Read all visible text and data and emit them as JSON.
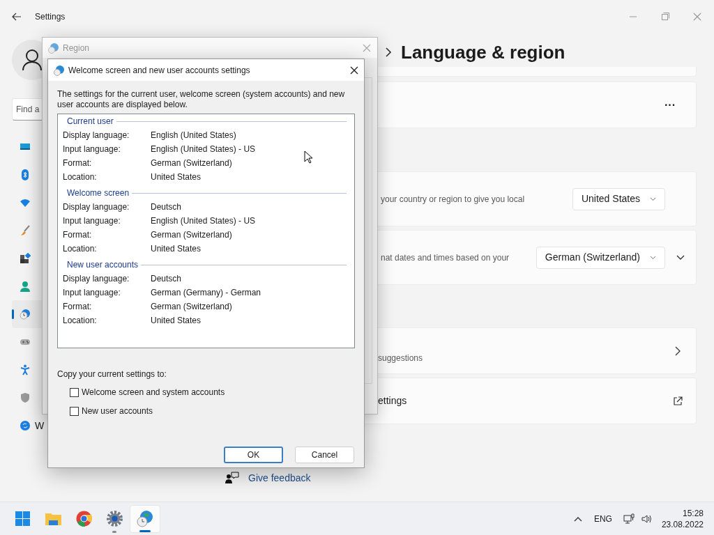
{
  "settings_window": {
    "title": "Settings",
    "search": {
      "placeholder": "Find a"
    },
    "nav": [
      {
        "kind": "display",
        "selected": false
      },
      {
        "kind": "bluetooth",
        "selected": false
      },
      {
        "kind": "wifi",
        "selected": false
      },
      {
        "kind": "brush",
        "selected": false
      },
      {
        "kind": "apps",
        "selected": false
      },
      {
        "kind": "account",
        "selected": false
      },
      {
        "kind": "time",
        "selected": true
      },
      {
        "kind": "gaming",
        "selected": false
      },
      {
        "kind": "accessibility",
        "selected": false
      },
      {
        "kind": "shield",
        "selected": false
      },
      {
        "kind": "update",
        "selected": false,
        "label": "W"
      }
    ],
    "heading": "Language & region",
    "cards": [
      {
        "kind": "partial"
      },
      {
        "kind": "more",
        "label": "···"
      },
      {
        "kind": "dropdown",
        "description": "your country or region to give you local",
        "value": "United States"
      },
      {
        "kind": "dropdown",
        "description": "nat dates and times based on your",
        "value": "German (Switzerland)",
        "expanded": false
      },
      {
        "kind": "link",
        "description": "suggestions"
      },
      {
        "kind": "external",
        "title": "ettings"
      }
    ],
    "feedback_link": "Give feedback"
  },
  "region_dialog": {
    "title": "Region"
  },
  "welcome_dialog": {
    "title": "Welcome screen and new user accounts settings",
    "intro": "The settings for the current user, welcome screen (system accounts) and new user accounts are displayed below.",
    "sections": [
      {
        "title": "Current user",
        "rows": [
          {
            "label": "Display language:",
            "value": "English (United States)"
          },
          {
            "label": "Input language:",
            "value": "English (United States) - US"
          },
          {
            "label": "Format:",
            "value": "German (Switzerland)"
          },
          {
            "label": "Location:",
            "value": "United States"
          }
        ]
      },
      {
        "title": "Welcome screen",
        "rows": [
          {
            "label": "Display language:",
            "value": "Deutsch"
          },
          {
            "label": "Input language:",
            "value": "English (United States) - US"
          },
          {
            "label": "Format:",
            "value": "German (Switzerland)"
          },
          {
            "label": "Location:",
            "value": "United States"
          }
        ]
      },
      {
        "title": "New user accounts",
        "rows": [
          {
            "label": "Display language:",
            "value": "Deutsch"
          },
          {
            "label": "Input language:",
            "value": "German (Germany) - German"
          },
          {
            "label": "Format:",
            "value": "German (Switzerland)"
          },
          {
            "label": "Location:",
            "value": "United States"
          }
        ]
      }
    ],
    "copy_label": "Copy your current settings to:",
    "checkboxes": [
      {
        "label": "Welcome screen and system accounts",
        "checked": false
      },
      {
        "label": "New user accounts",
        "checked": false
      }
    ],
    "buttons": [
      {
        "label": "OK",
        "default": true
      },
      {
        "label": "Cancel",
        "default": false
      }
    ]
  },
  "taskbar": {
    "apps": [
      {
        "kind": "start",
        "running": false,
        "selected": false
      },
      {
        "kind": "folder",
        "running": false,
        "selected": false
      },
      {
        "kind": "browser",
        "running": false,
        "selected": false
      },
      {
        "kind": "settings",
        "running": true,
        "selected": false
      },
      {
        "kind": "region",
        "running": true,
        "selected": true
      }
    ],
    "language": "ENG",
    "time": "15:28",
    "date": "23.08.2022"
  }
}
